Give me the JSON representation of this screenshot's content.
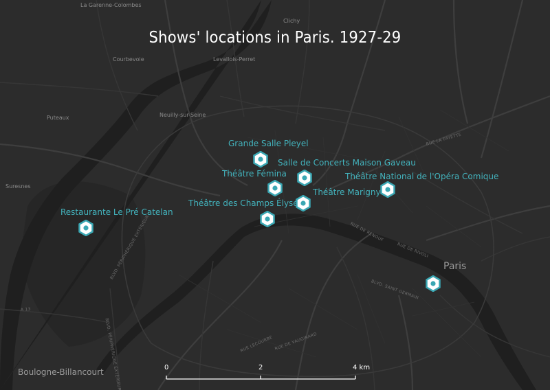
{
  "title": "Shows' locations in Paris. 1927-29",
  "colors": {
    "background": "#2c2c2c",
    "marker_fill": "#ffffff",
    "marker_stroke": "#3aa7b3",
    "label": "#43b3bd",
    "road": "#3e3e3e",
    "river": "#1f1f1f"
  },
  "places": {
    "la_garenne": "La Garenne-Colombes",
    "clichy": "Clichy",
    "courbevoie": "Courbevoie",
    "levallois": "Levallois-Perret",
    "puteaux": "Puteaux",
    "neuilly": "Neuilly-sur-Seine",
    "suresnes": "Suresnes",
    "paris": "Paris",
    "boulogne": "Boulogne-Billancourt"
  },
  "streets": {
    "lafayette": "RUE LA FAYETTE",
    "renouf": "RUE DE RENOUF",
    "rivoli": "RUE DE RIVOLI",
    "st_germain": "BLVD. SAINT GERMAIN",
    "lecourbe": "RUE LECOURBE",
    "vaugirard": "RUE DE VAUGIRARD",
    "peripherique1": "BLVD. PÉRIPHÉRIQUE EXTÉRIEUR",
    "peripherique2": "BLVD. PÉRIPHÉRIQUE EXTÉRIEUR",
    "a13": "A 13"
  },
  "venues": [
    {
      "name": "Grande Salle Pleyel",
      "label_anchor": "above"
    },
    {
      "name": "Salle de Concerts Maison Gaveau",
      "label_anchor": "above"
    },
    {
      "name": "Théâtre Fémina",
      "label_anchor": "above"
    },
    {
      "name": "Théâtre National de l'Opéra Comique",
      "label_anchor": "above"
    },
    {
      "name": "Théâtre Marigny",
      "label_anchor": "above"
    },
    {
      "name": "Théâtre des Champs Élysées",
      "label_anchor": "above"
    },
    {
      "name": "Restaurante Le Pré Catelan",
      "label_anchor": "above"
    },
    {
      "name": "",
      "label_anchor": "none"
    }
  ],
  "scalebar": {
    "ticks": [
      "0",
      "2",
      "4 km"
    ],
    "unit": "km"
  }
}
